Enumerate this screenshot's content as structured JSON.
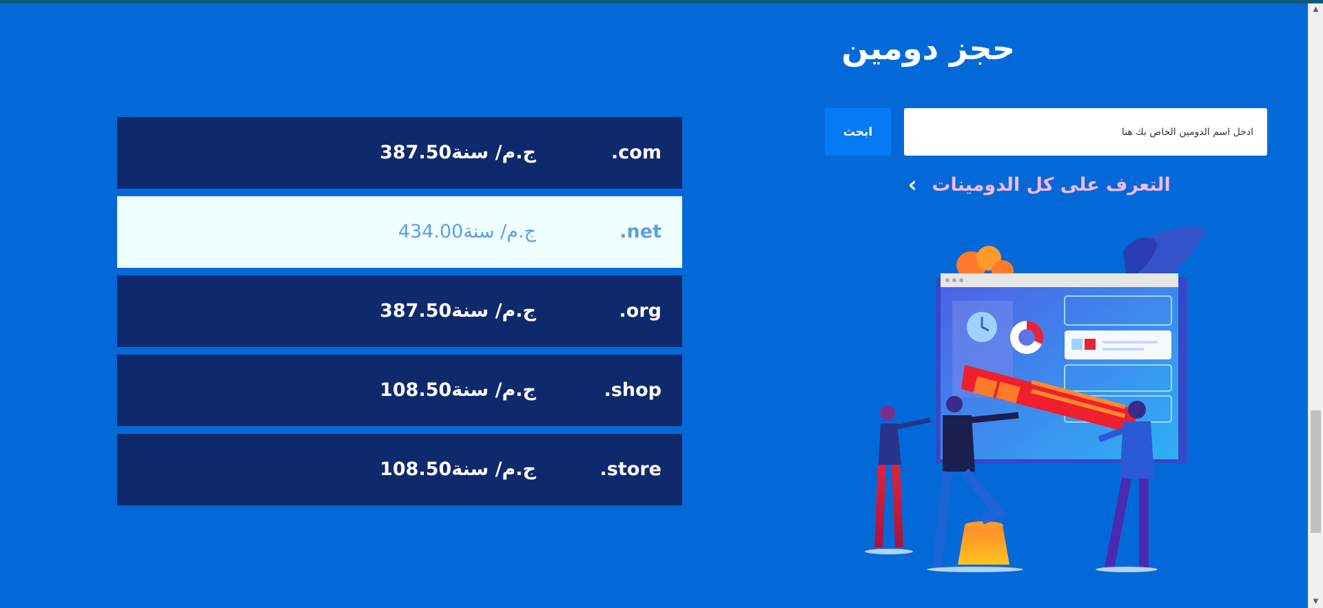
{
  "section": {
    "title": "حجز دومين"
  },
  "search": {
    "placeholder": "ادخل اسم الدومين الخاص بك هنا",
    "button_label": "ابحث"
  },
  "all_domains_link": {
    "label": "التعرف على كل الدومينات",
    "icon": "chevron-left-icon"
  },
  "domains": [
    {
      "ext": ".com",
      "price": "387.50ج.م/ سنة",
      "highlighted": false
    },
    {
      "ext": ".net",
      "price": "434.00ج.م/ سنة",
      "highlighted": true
    },
    {
      "ext": ".org",
      "price": "387.50ج.م/ سنة",
      "highlighted": false
    },
    {
      "ext": ".shop",
      "price": "108.50ج.م/ سنة",
      "highlighted": false
    },
    {
      "ext": ".store",
      "price": "108.50ج.م/ سنة",
      "highlighted": false
    }
  ],
  "colors": {
    "background": "#0469d8",
    "row": "#0f296d",
    "row_highlight": "#effeff",
    "button": "#047bf4",
    "link_text": "#f7b8e8"
  }
}
